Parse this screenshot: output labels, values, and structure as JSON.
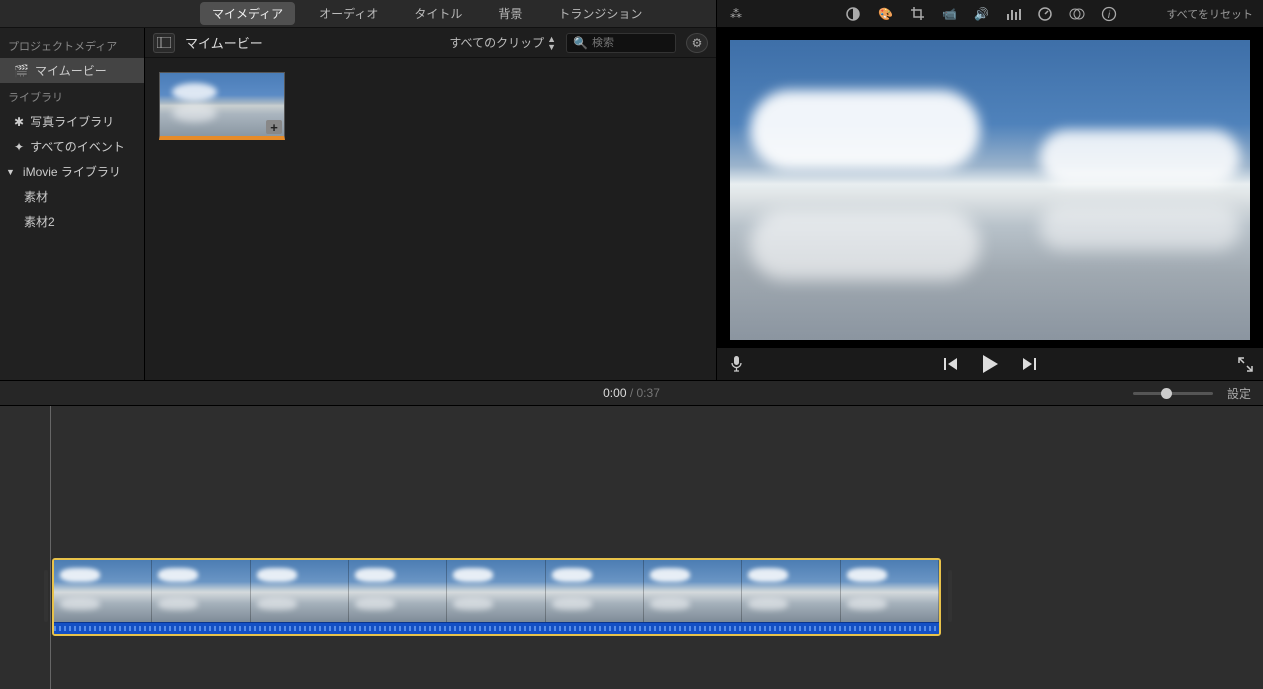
{
  "tabs": {
    "my_media": "マイメディア",
    "audio": "オーディオ",
    "title": "タイトル",
    "background": "背景",
    "transition": "トランジション"
  },
  "sidebar": {
    "project_media_hdr": "プロジェクトメディア",
    "my_movie": "マイムービー",
    "library_hdr": "ライブラリ",
    "photo_library": "写真ライブラリ",
    "all_events": "すべてのイベント",
    "imovie_library": "iMovie ライブラリ",
    "material1": "素材",
    "material2": "素材2"
  },
  "browser": {
    "title": "マイムービー",
    "clip_filter": "すべてのクリップ",
    "search_placeholder": "検索"
  },
  "viewer": {
    "reset_all": "すべてをリセット"
  },
  "timebar": {
    "current": "0:00",
    "duration": "0:37",
    "settings": "設定"
  }
}
